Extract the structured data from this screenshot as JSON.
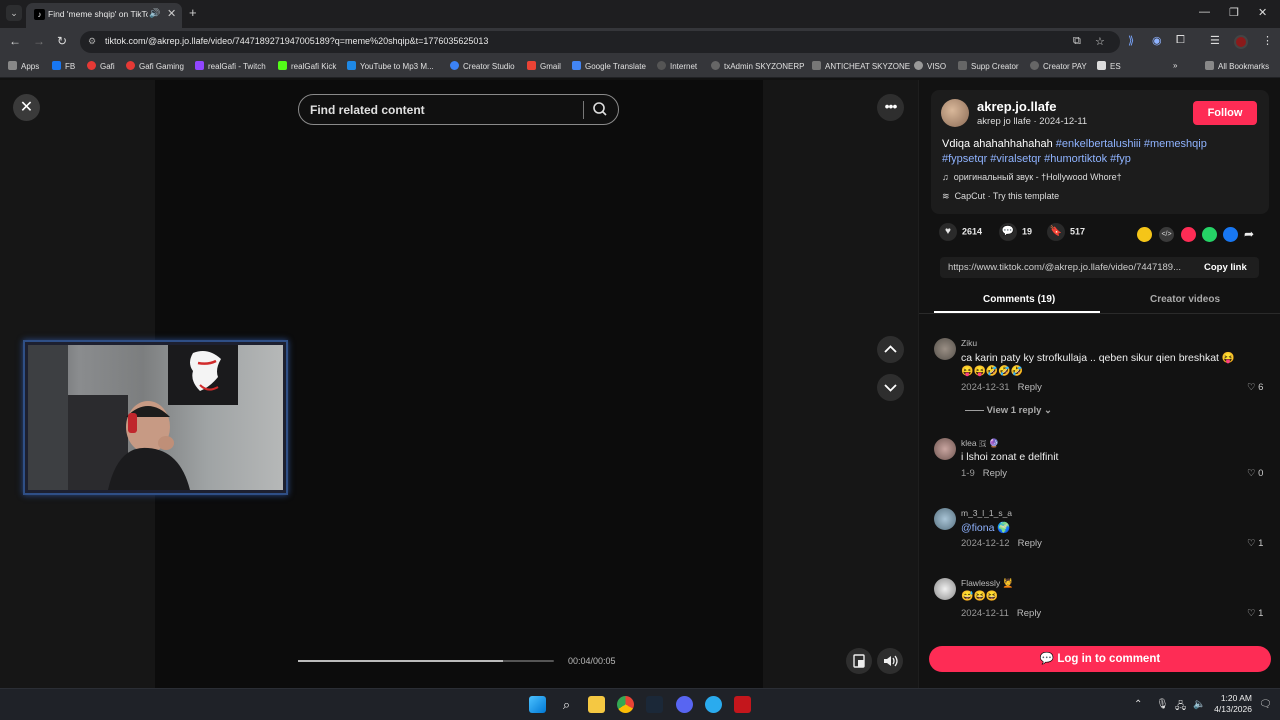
{
  "browser": {
    "tab_title": "Find 'meme shqip' on TikTok",
    "url": "tiktok.com/@akrep.jo.llafe/video/7447189271947005189?q=meme%20shqip&t=1776035625013",
    "bookmarks": [
      "Apps",
      "FB",
      "Gafi",
      "Gafi Gaming",
      "realGafi - Twitch",
      "realGafi Kick",
      "YouTube to Mp3 M...",
      "Creator Studio",
      "Gmail",
      "Google Translate",
      "Internet",
      "txAdmin SKYZONERP",
      "ANTICHEAT SKYZONE",
      "VISO",
      "Supp Creator",
      "Creator PAY",
      "ES"
    ],
    "all_bookmarks": "All Bookmarks"
  },
  "video": {
    "search_placeholder": "Find related content",
    "timecode": "00:04/00:05",
    "progress": 0.8
  },
  "creator": {
    "handle": "akrep.jo.llafe",
    "sub": "akrep jo llafe · 2024-12-11",
    "follow_label": "Follow",
    "caption_text": "Vdiqa ahahahhahahah",
    "hashtags_line1": "#enkelbertalushiii #memeshqip",
    "hashtags_line2": "#fypsetqr #viralsetqr #humortiktok #fyp",
    "music": "оригинальный звук - †Hollywood Whore†",
    "capcut": "CapCut · Try this template"
  },
  "stats": {
    "likes": "2614",
    "comments": "19",
    "saves": "517"
  },
  "link": {
    "url": "https://www.tiktok.com/@akrep.jo.llafe/video/7447189...",
    "copy_label": "Copy link"
  },
  "tabs": {
    "comments": "Comments (19)",
    "creator_videos": "Creator videos"
  },
  "comments": [
    {
      "user": "Ziku",
      "text": "ca karin paty ky strofkullaja .. qeben sikur qien breshkat 😝",
      "emoji": "😝😝🤣🤣🤣",
      "date": "2024-12-31",
      "reply": "Reply",
      "likes": "6",
      "view_replies": "View 1 reply"
    },
    {
      "user": "klea 🇬 🔮",
      "text": "i lshoi zonat e delfinit",
      "date": "1-9",
      "reply": "Reply",
      "likes": "0"
    },
    {
      "user": "m_3_l_1_s_a",
      "text": "@fiona 🌍",
      "date": "2024-12-12",
      "reply": "Reply",
      "likes": "1"
    },
    {
      "user": "Flawlessly 💆",
      "emoji": "😅😆😆",
      "date": "2024-12-11",
      "reply": "Reply",
      "likes": "1"
    }
  ],
  "login_label": "Log in to comment",
  "clock": {
    "time": "1:20 AM",
    "date": "4/13/2026"
  },
  "colors": {
    "accent": "#fe2c55",
    "hashtag": "#8fb3ff",
    "webcam_border": "#2f4f86"
  }
}
